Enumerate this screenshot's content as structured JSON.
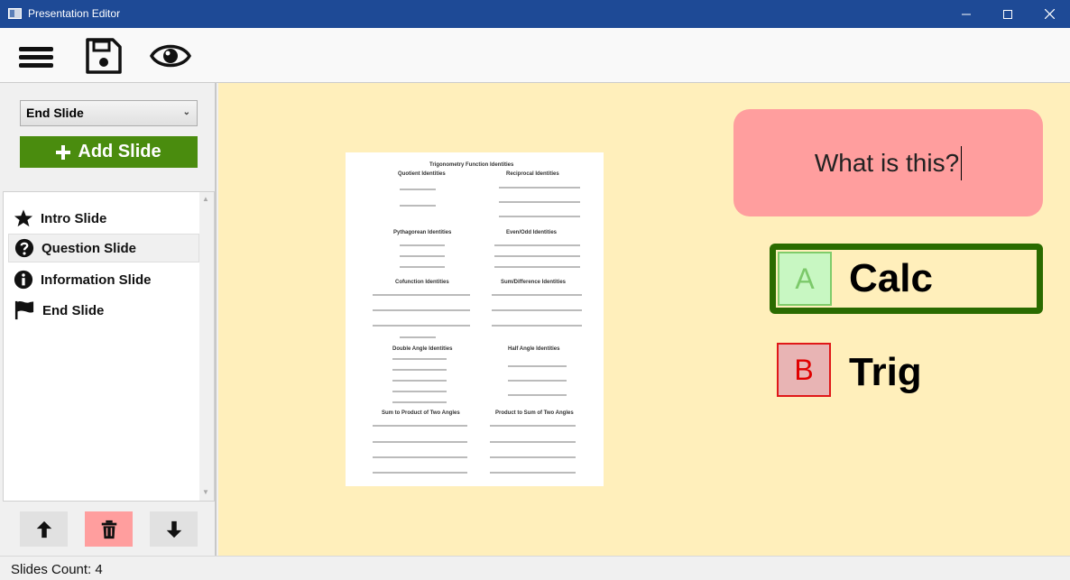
{
  "window": {
    "title": "Presentation Editor"
  },
  "toolbar": {
    "icons": [
      "menu-icon",
      "save-icon",
      "preview-eye-icon"
    ]
  },
  "sidebar": {
    "slide_type_select": "End Slide",
    "add_slide_label": "Add Slide",
    "slides": [
      {
        "label": "Intro Slide",
        "icon": "star-icon"
      },
      {
        "label": "Question Slide",
        "icon": "question-circle-icon",
        "selected": true
      },
      {
        "label": "Information Slide",
        "icon": "info-circle-icon"
      },
      {
        "label": "End Slide",
        "icon": "flag-icon"
      }
    ]
  },
  "canvas": {
    "background": "#ffefbb",
    "image_title": "Trigonometry Function Identities",
    "image_sections": [
      "Quotient Identities",
      "Reciprocal Identities",
      "Pythagorean Identities",
      "Even/Odd Identities",
      "Cofunction Identities",
      "Sum/Difference Identities",
      "Double Angle Identities",
      "Half Angle Identities",
      "Sum to Product of Two Angles",
      "Product to Sum of Two Angles"
    ],
    "question_text": "What is this?",
    "answers": [
      {
        "letter": "A",
        "text": "Calc",
        "selected": true
      },
      {
        "letter": "B",
        "text": "Trig"
      }
    ]
  },
  "status": {
    "text": "Slides Count: 4"
  },
  "colors": {
    "titlebar": "#1e4a96",
    "add_button": "#4a8c0e",
    "question_bg": "#ff9e9e",
    "answer_a_border": "#2a6b00",
    "answer_b_border": "#e01818",
    "delete_button": "#ff9e9e"
  }
}
